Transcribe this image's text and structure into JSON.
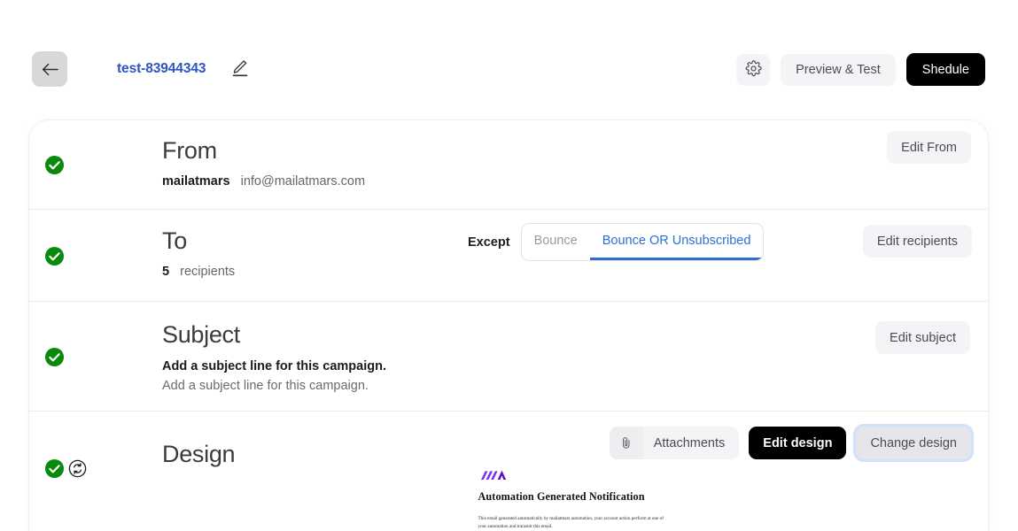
{
  "topbar": {
    "back_icon": "arrow-left-icon",
    "campaign_name": "test-83944343",
    "edit_icon": "pencil-icon",
    "settings_icon": "gear-icon",
    "preview_test_label": "Preview & Test",
    "schedule_label": "Shedule"
  },
  "sections": {
    "from": {
      "status_icon": "green-check-icon",
      "title": "From",
      "sender_name": "mailatmars",
      "sender_email": "info@mailatmars.com",
      "action_label": "Edit From"
    },
    "to": {
      "status_icon": "green-check-icon",
      "title": "To",
      "recipient_count": "5",
      "recipient_label": "recipients",
      "except_label": "Except",
      "tabs": [
        {
          "label": "Bounce",
          "active": false
        },
        {
          "label": "Bounce OR Unsubscribed",
          "active": true
        }
      ],
      "action_label": "Edit recipients"
    },
    "subject": {
      "status_icon": "green-check-icon",
      "title": "Subject",
      "line_primary": "Add a subject line for this campaign.",
      "line_secondary": "Add a subject line for this campaign.",
      "action_label": "Edit subject"
    },
    "design": {
      "status_icon": "green-check-icon",
      "sync_icon": "sync-refresh-icon",
      "title": "Design",
      "attachments_icon": "paperclip-icon",
      "attachments_label": "Attachments",
      "edit_design_label": "Edit design",
      "change_design_label": "Change design",
      "preview": {
        "logo": "mailatmars-logo",
        "heading": "Automation Generated Notification",
        "body": "This email generated automatically by mailatmars automation, your account action perform at one of your automation and transmit this email."
      }
    }
  },
  "colors": {
    "accent_blue": "#2f6fd0",
    "link_blue": "#2f55c4",
    "success_green": "#1a8a1a",
    "dark_button": "#000000",
    "logo_purple": "#6a1fd0"
  }
}
